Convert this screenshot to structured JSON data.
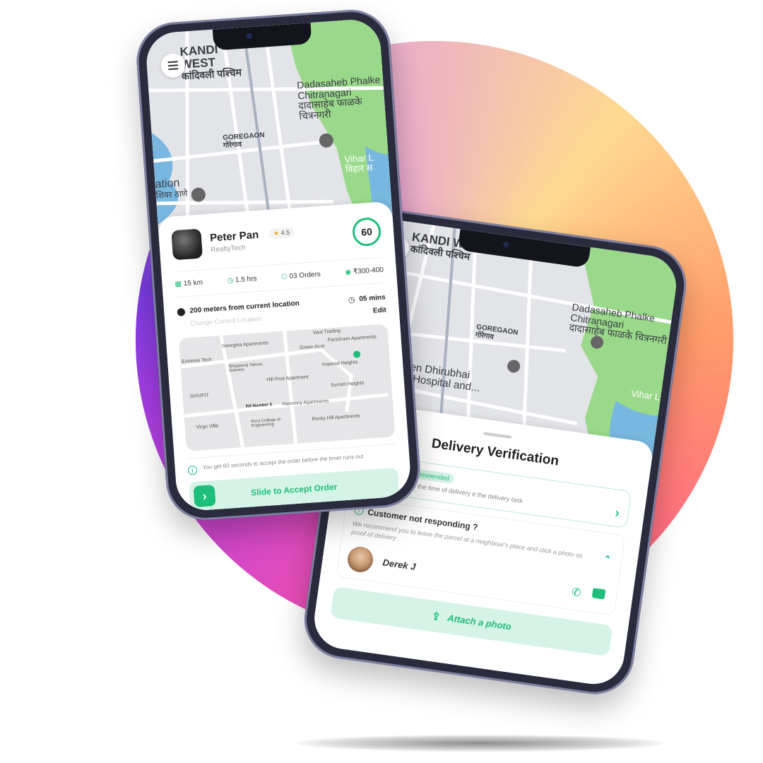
{
  "map": {
    "area_name_en": "KANDI WEST",
    "area_name_hi": "कांदिवली पश्चिम",
    "park_name_en": "Dadasaheb Phalke Chitranagari",
    "park_name_hi": "दादासाहेब फाळके चित्रनगरी",
    "goregaon_en": "GOREGAON",
    "goregaon_hi": "गोरेगाव",
    "vihar_en": "Vihar L",
    "vihar_hi": "विहार स",
    "station_en": "ation",
    "station_hi": "शिवर ठाणे",
    "hospital": "Kokilaben Dhirubhai Ambani Hospital and..."
  },
  "order": {
    "name": "Peter Pan",
    "company": "RealtyTech",
    "rating": "4.5",
    "timer": "60",
    "distance": "15 km",
    "duration": "1.5 hrs",
    "orders": "03 Orders",
    "price": "₹300-400",
    "location": "200 meters from current location",
    "change_location": "Change Current Location",
    "eta": "05 mins",
    "edit": "Edit",
    "notice": "You get 60 seconds to accept the order before the timer runs out",
    "slide_label": "Slide to Accept Order",
    "mini_map_labels": [
      "Vaut Trading",
      "Georgina Apartments",
      "Green Acre",
      "Parishram Apartments",
      "Bhagwanji Takout, Delivery",
      "Imperial Heights",
      "Hill Post Apartment",
      "Sunset Heights",
      "SHIVFIT",
      "Rd Number 5",
      "Harmony Apartments",
      "Virgo Villa",
      "Rizvi College of Engineering",
      "Rocky Hill Apartments",
      "Extreme Tech"
    ]
  },
  "verify": {
    "title": "Delivery Verification",
    "otp_title": "rification",
    "otp_badge": "Recommended",
    "otp_desc": "TP from customer at the time of delivery e the delivery task",
    "nr_title": "Customer not responding ?",
    "nr_desc": "We recommend you to leave the parcel at a neighbour's place and click a photo as proof of delivery",
    "contact_name": "Derek J",
    "attach_label": "Attach a photo"
  },
  "colors": {
    "accent": "#1dbf7a",
    "accent_light": "#d5f3e6",
    "park_green": "#9ad98a",
    "water": "#78b8e0",
    "frame": "#2a2c3e"
  }
}
